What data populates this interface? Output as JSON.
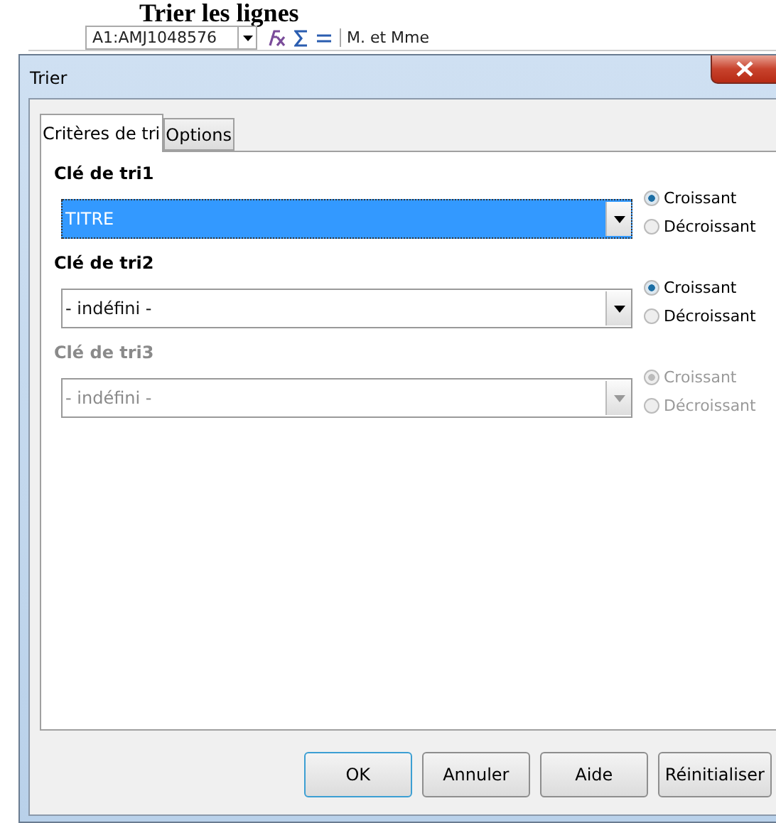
{
  "heading": "Trier les lignes",
  "formula_bar": {
    "cell_range": "A1:AMJ1048576",
    "content": "M. et Mme"
  },
  "window": {
    "title": "Trier"
  },
  "tabs": [
    {
      "label": "Critères de tri",
      "selected": true
    },
    {
      "label": "Options",
      "selected": false
    }
  ],
  "sort_keys": [
    {
      "label": "Clé de tri1",
      "value": "TITRE",
      "highlighted": true,
      "disabled": false,
      "options": [
        {
          "label": "Croissant",
          "selected": true
        },
        {
          "label": "Décroissant",
          "selected": false
        }
      ]
    },
    {
      "label": "Clé de tri2",
      "value": "- indéfini -",
      "highlighted": false,
      "disabled": false,
      "options": [
        {
          "label": "Croissant",
          "selected": true
        },
        {
          "label": "Décroissant",
          "selected": false
        }
      ]
    },
    {
      "label": "Clé de tri3",
      "value": "- indéfini -",
      "highlighted": false,
      "disabled": true,
      "options": [
        {
          "label": "Croissant",
          "selected": true
        },
        {
          "label": "Décroissant",
          "selected": false
        }
      ]
    }
  ],
  "buttons": [
    {
      "label": "OK",
      "default": true
    },
    {
      "label": "Annuler",
      "default": false
    },
    {
      "label": "Aide",
      "default": false
    },
    {
      "label": "Réinitialiser",
      "default": false
    }
  ]
}
